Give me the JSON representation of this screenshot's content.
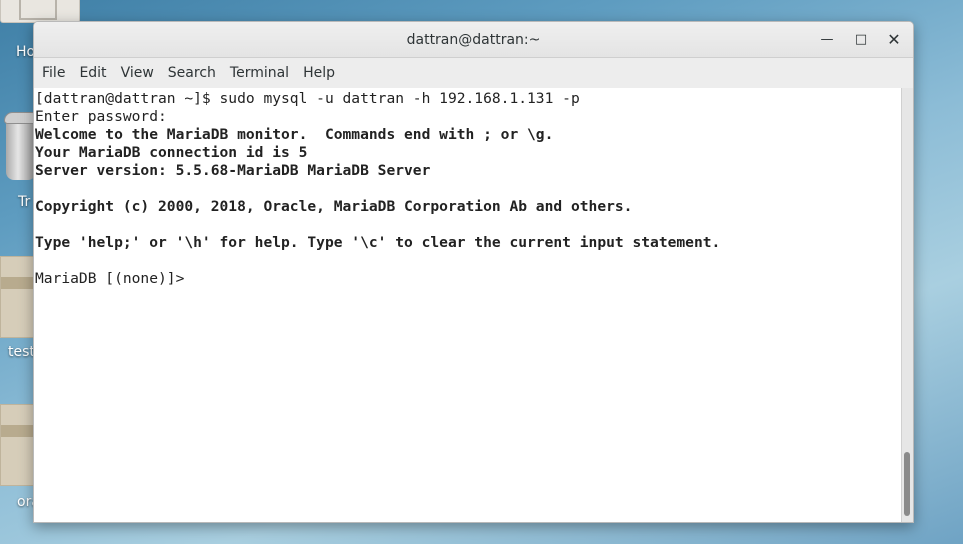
{
  "desktop": {
    "icons": [
      {
        "label": "Ho"
      },
      {
        "label": "Tr"
      },
      {
        "label": "test"
      },
      {
        "label": "ora"
      }
    ]
  },
  "window": {
    "title": "dattran@dattran:~",
    "minimize_glyph": "—",
    "maximize_glyph": "□",
    "close_glyph": "✕"
  },
  "menu": [
    "File",
    "Edit",
    "View",
    "Search",
    "Terminal",
    "Help"
  ],
  "terminal": {
    "lines": [
      "[dattran@dattran ~]$ sudo mysql -u dattran -h 192.168.1.131 -p",
      "Enter password:",
      "Welcome to the MariaDB monitor.  Commands end with ; or \\g.",
      "Your MariaDB connection id is 5",
      "Server version: 5.5.68-MariaDB MariaDB Server",
      "",
      "Copyright (c) 2000, 2018, Oracle, MariaDB Corporation Ab and others.",
      "",
      "Type 'help;' or '\\h' for help. Type '\\c' to clear the current input statement.",
      "",
      "MariaDB [(none)]>"
    ]
  }
}
